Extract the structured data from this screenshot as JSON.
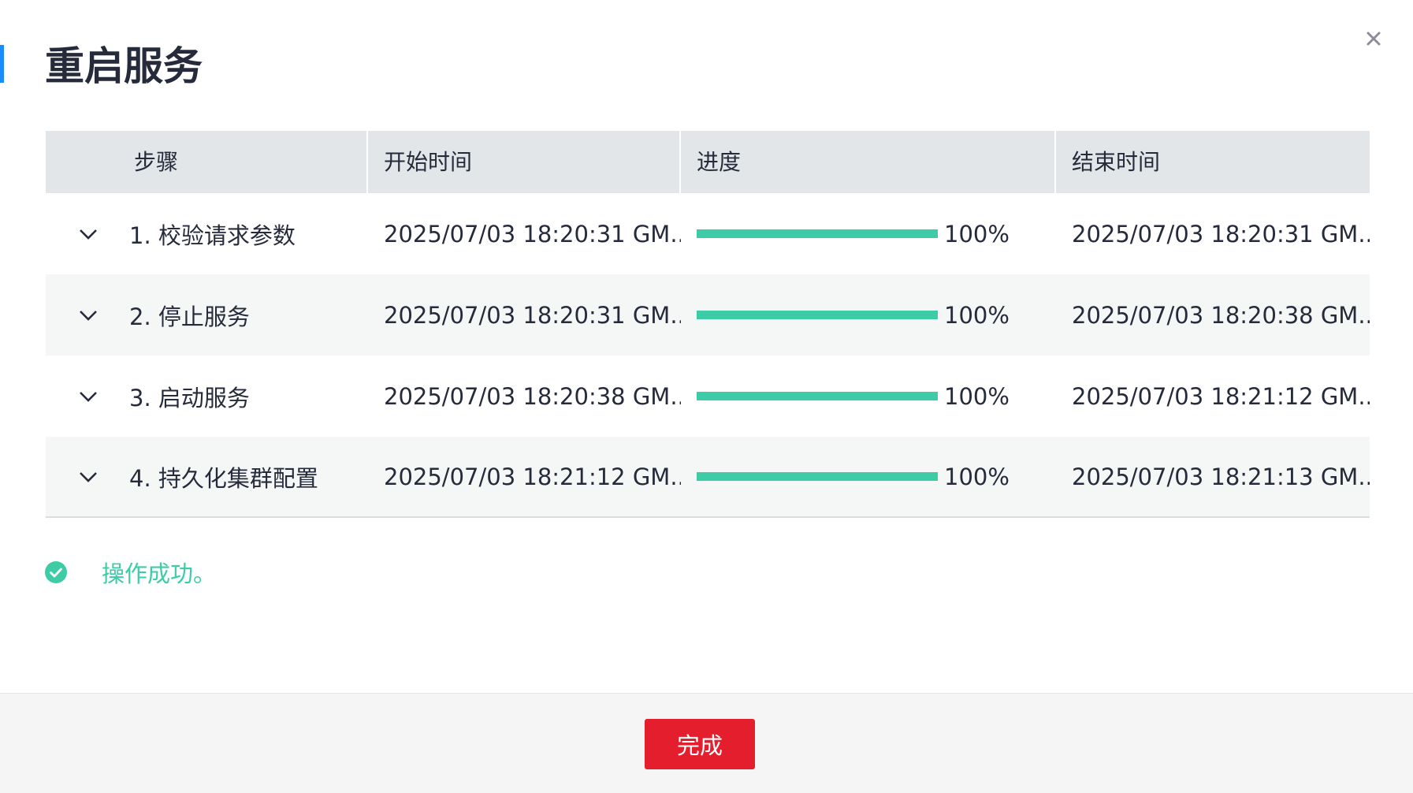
{
  "dialog": {
    "title": "重启服务",
    "close_icon": "close-icon",
    "accent_color": "#1a8cff"
  },
  "table": {
    "headers": [
      "步骤",
      "开始时间",
      "进度",
      "结束时间"
    ],
    "rows": [
      {
        "step": "1. 校验请求参数",
        "start": "2025/07/03 18:20:31 GM...",
        "progress": 100,
        "progress_label": "100%",
        "end": "2025/07/03 18:20:31 GM..."
      },
      {
        "step": "2. 停止服务",
        "start": "2025/07/03 18:20:31 GM...",
        "progress": 100,
        "progress_label": "100%",
        "end": "2025/07/03 18:20:38 GM..."
      },
      {
        "step": "3. 启动服务",
        "start": "2025/07/03 18:20:38 GM...",
        "progress": 100,
        "progress_label": "100%",
        "end": "2025/07/03 18:21:12 GM..."
      },
      {
        "step": "4. 持久化集群配置",
        "start": "2025/07/03 18:21:12 GM...",
        "progress": 100,
        "progress_label": "100%",
        "end": "2025/07/03 18:21:13 GM..."
      }
    ],
    "expand_icon": "chevron-down-icon"
  },
  "status": {
    "text": "操作成功。",
    "icon": "check-circle-icon",
    "color": "#3dcca6"
  },
  "footer": {
    "done_label": "完成",
    "done_color": "#e41e2c"
  }
}
